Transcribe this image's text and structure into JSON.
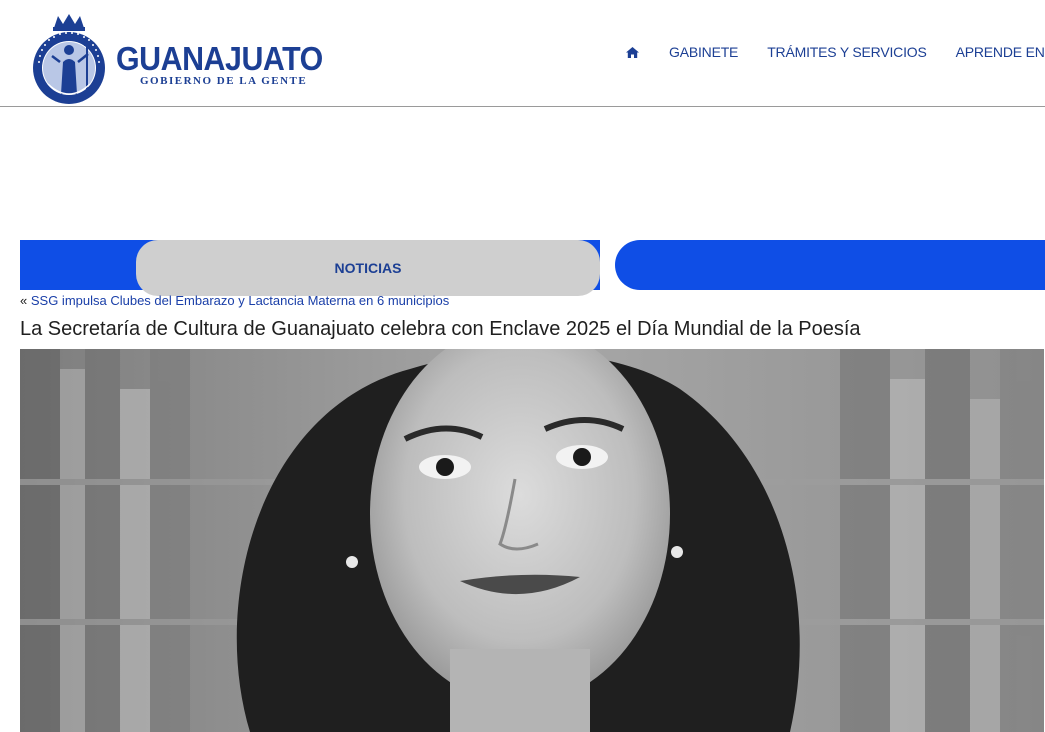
{
  "header": {
    "logo": {
      "title": "GUANAJUATO",
      "subtitle": "GOBIERNO DE LA GENTE",
      "seal_icon": "state-seal-icon",
      "seal_text": "GOBIERNO DEL ESTADO DE GUANAJUATO",
      "seal_years_left": "2024",
      "seal_years_right": "2030"
    },
    "nav": {
      "home_icon": "home-icon",
      "items": [
        {
          "label": "GABINETE"
        },
        {
          "label": "TRÁMITES Y SERVICIOS"
        },
        {
          "label": "APRENDE EN GT"
        }
      ]
    }
  },
  "tabs": {
    "active_label": "NOTICIAS"
  },
  "article": {
    "prev_marker": "«",
    "prev_link": "SSG impulsa Clubes del Embarazo y Lactancia Materna en 6 municipios",
    "title": "La Secretaría de Cultura de Guanajuato celebra con Enclave 2025 el Día Mundial de la Poesía",
    "photo_icon": "portrait-photo"
  },
  "colors": {
    "brand_blue": "#1c3f94",
    "tab_blue": "#0f4ee6",
    "tab_active_bg": "#cfcfcf",
    "link_blue": "#1a3fa8",
    "title_text": "#1f1f1f"
  }
}
